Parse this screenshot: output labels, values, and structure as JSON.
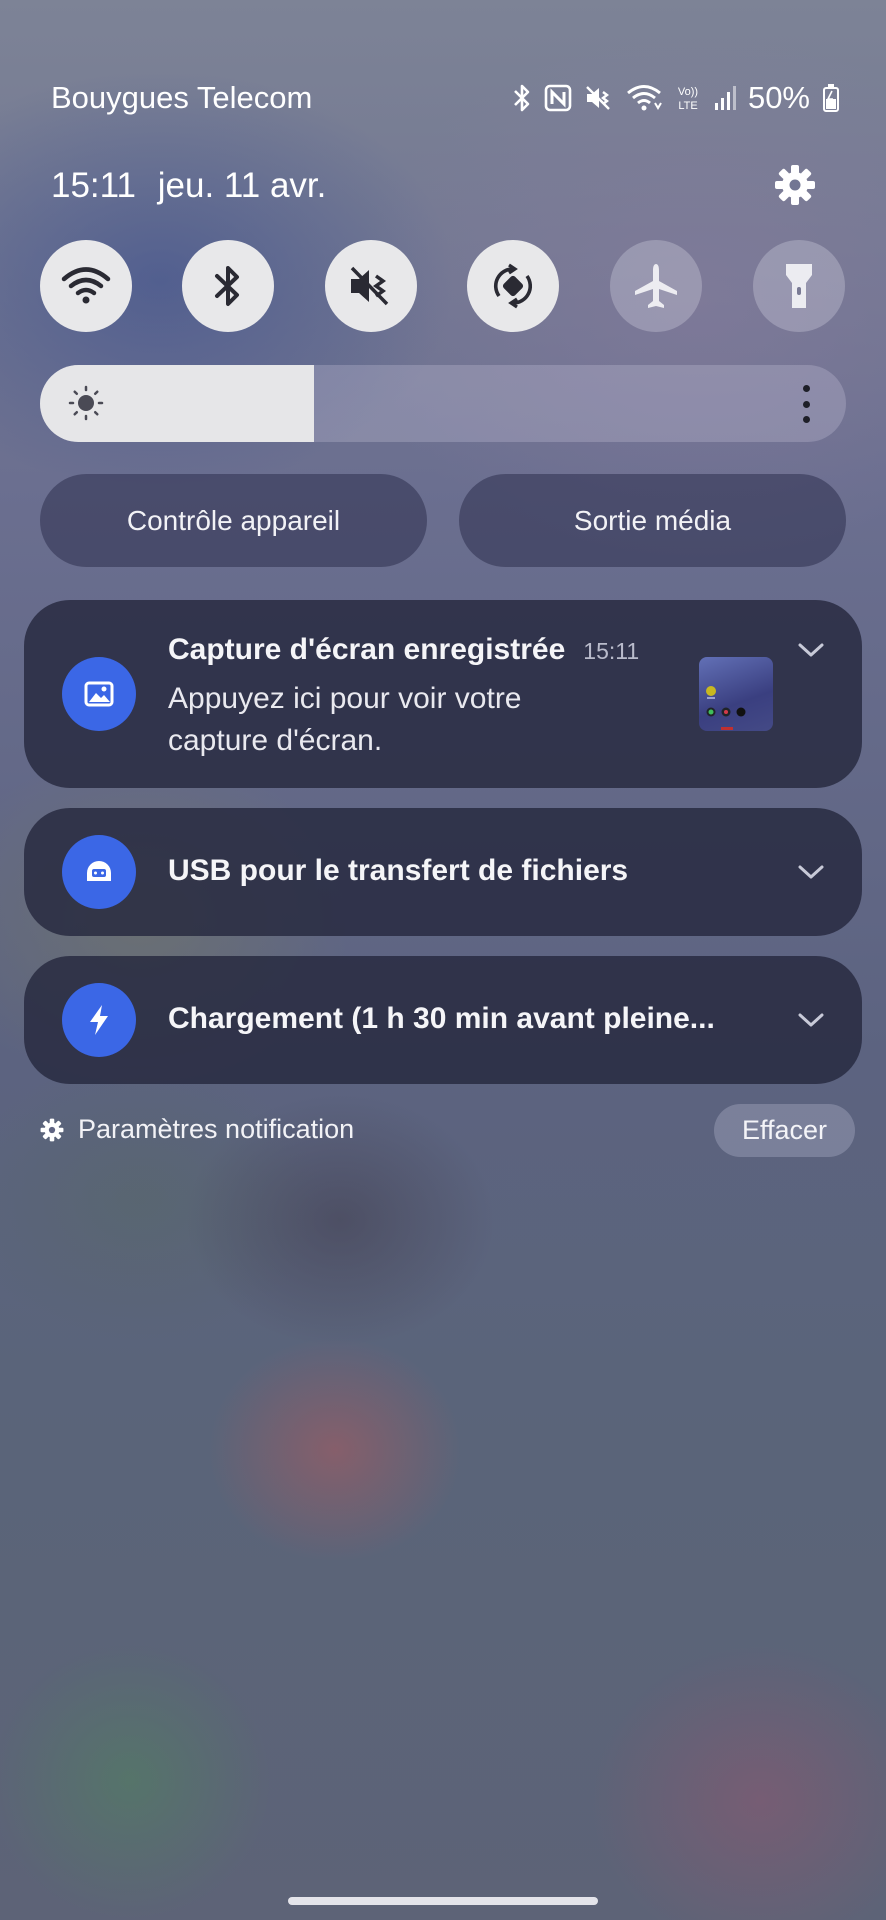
{
  "status_bar": {
    "carrier": "Bouygues Telecom",
    "battery": "50%",
    "icons": [
      "bluetooth-icon",
      "nfc-icon",
      "vibrate-mute-icon",
      "wifi-icon",
      "volte-icon",
      "signal-icon",
      "battery-charging-icon"
    ]
  },
  "header": {
    "time": "15:11",
    "date": "jeu. 11 avr."
  },
  "quick_toggles": [
    {
      "name": "wifi",
      "state": "on"
    },
    {
      "name": "bluetooth",
      "state": "on"
    },
    {
      "name": "sound-mute",
      "state": "on"
    },
    {
      "name": "auto-rotate",
      "state": "on"
    },
    {
      "name": "airplane-mode",
      "state": "off"
    },
    {
      "name": "flashlight",
      "state": "off"
    }
  ],
  "brightness": {
    "level": 0.34
  },
  "buttons": {
    "device_control": "Contrôle appareil",
    "media_output": "Sortie média"
  },
  "notifications": [
    {
      "title": "Capture d'écran enregistrée",
      "time": "15:11",
      "body_line1": "Appuyez ici pour voir votre",
      "body_line2": "capture d'écran.",
      "icon": "image-icon"
    },
    {
      "title": "USB pour le transfert de fichiers",
      "icon": "usb-icon"
    },
    {
      "title": "Chargement (1 h 30 min avant pleine...",
      "icon": "bolt-icon"
    }
  ],
  "footer": {
    "notification_settings": "Paramètres notification",
    "clear": "Effacer"
  },
  "colors": {
    "accent": "#3b67e6",
    "toggle_on": "#e8e8ea"
  }
}
